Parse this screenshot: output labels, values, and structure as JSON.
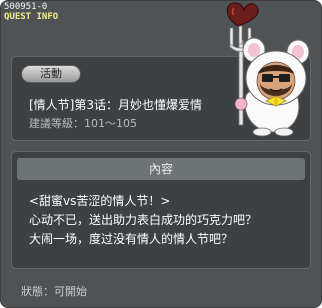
{
  "window": {
    "quest_id": "500951-0",
    "header_label": "QUEST INFO"
  },
  "quest": {
    "badge": "活動",
    "title": "[情人节]第3话：月妙也懂爆爱情",
    "level": "建議等級：101～105"
  },
  "content": {
    "header": "內容",
    "lines": [
      "<甜蜜vs苦涩的情人节！>",
      "心动不已，送出助力表白成功的巧克力吧？",
      "大闹一场，度过没有情人的情人节吧？"
    ]
  },
  "status": {
    "text": "狀態：可開始"
  },
  "character": {
    "icon": "bunny-suit-npc-holding-heart-fork"
  }
}
